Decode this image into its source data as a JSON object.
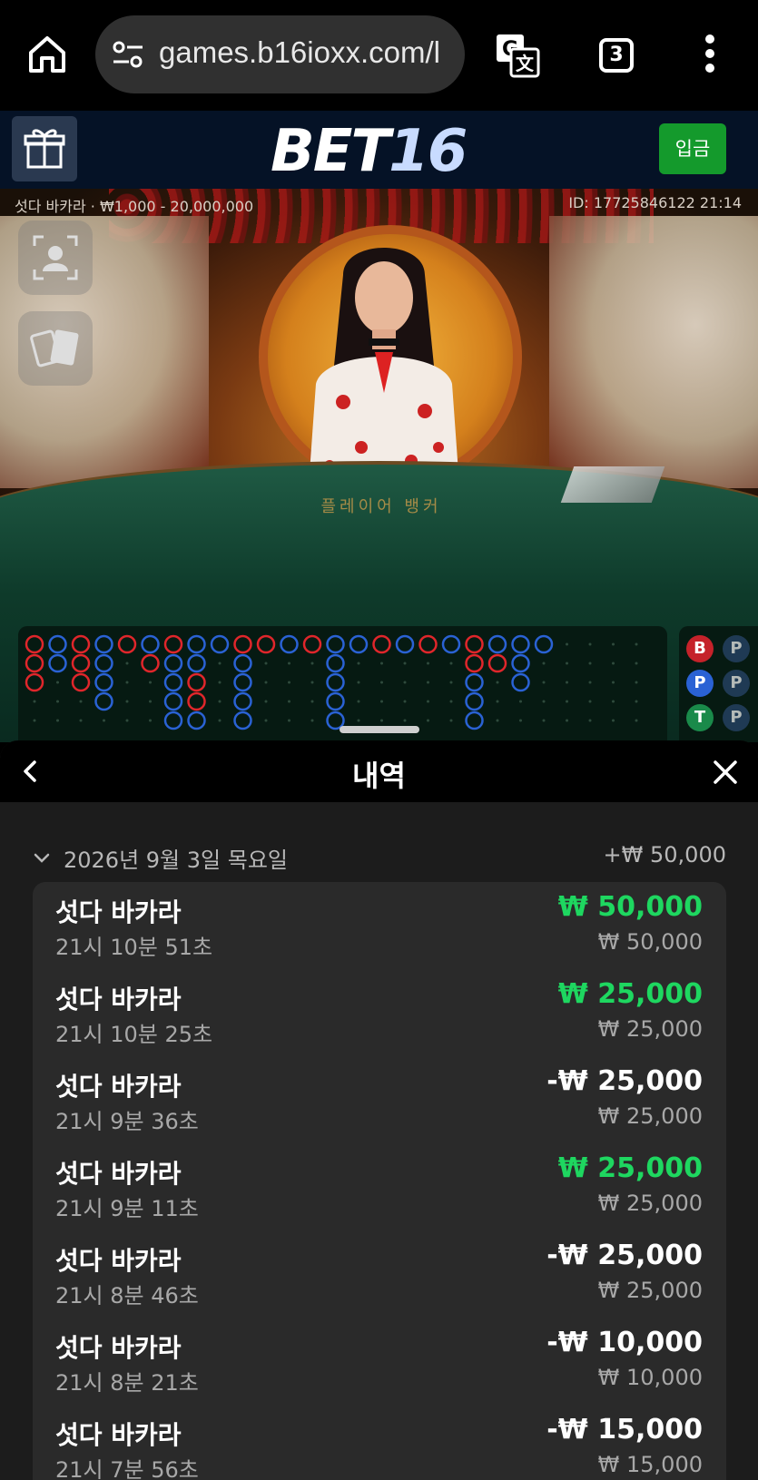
{
  "browser": {
    "url": "games.b16ioxx.com/l",
    "tab_count": "3"
  },
  "header": {
    "logo_part1": "BET",
    "logo_part2": "16",
    "deposit_label": "입금"
  },
  "game": {
    "info": "섯다 바카라 · ₩1,000 - 20,000,000",
    "id": "ID: 17725846122 21:14",
    "felt_label": "플레이어 뱅커"
  },
  "roadmap_side": [
    "B",
    "P",
    "P",
    "P",
    "T",
    "P"
  ],
  "sheet": {
    "title": "내역",
    "date": "2026년 9월 3일 목요일",
    "date_total": "+₩ 50,000",
    "rows": [
      {
        "name": "섯다 바카라",
        "time": "21시 10분 51초",
        "amount": "₩ 50,000",
        "bet": "₩ 50,000",
        "win": true
      },
      {
        "name": "섯다 바카라",
        "time": "21시 10분 25초",
        "amount": "₩ 25,000",
        "bet": "₩ 25,000",
        "win": true
      },
      {
        "name": "섯다 바카라",
        "time": "21시 9분 36초",
        "amount": "-₩ 25,000",
        "bet": "₩ 25,000",
        "win": false
      },
      {
        "name": "섯다 바카라",
        "time": "21시 9분 11초",
        "amount": "₩ 25,000",
        "bet": "₩ 25,000",
        "win": true
      },
      {
        "name": "섯다 바카라",
        "time": "21시 8분 46초",
        "amount": "-₩ 25,000",
        "bet": "₩ 25,000",
        "win": false
      },
      {
        "name": "섯다 바카라",
        "time": "21시 8분 21초",
        "amount": "-₩ 10,000",
        "bet": "₩ 10,000",
        "win": false
      },
      {
        "name": "섯다 바카라",
        "time": "21시 7분 56초",
        "amount": "-₩ 15,000",
        "bet": "₩ 15,000",
        "win": false
      }
    ]
  },
  "colors": {
    "win": "#1ed760",
    "deposit": "#149a2c",
    "banker_red": "#e0262b",
    "player_blue": "#2a62d4",
    "tie_green": "#1a8a4a"
  },
  "icons": [
    "home-icon",
    "site-info-icon",
    "translate-icon",
    "more-menu-icon",
    "gift-icon",
    "camera-icon",
    "cards-icon",
    "back-icon",
    "close-icon",
    "chevron-down-icon"
  ]
}
